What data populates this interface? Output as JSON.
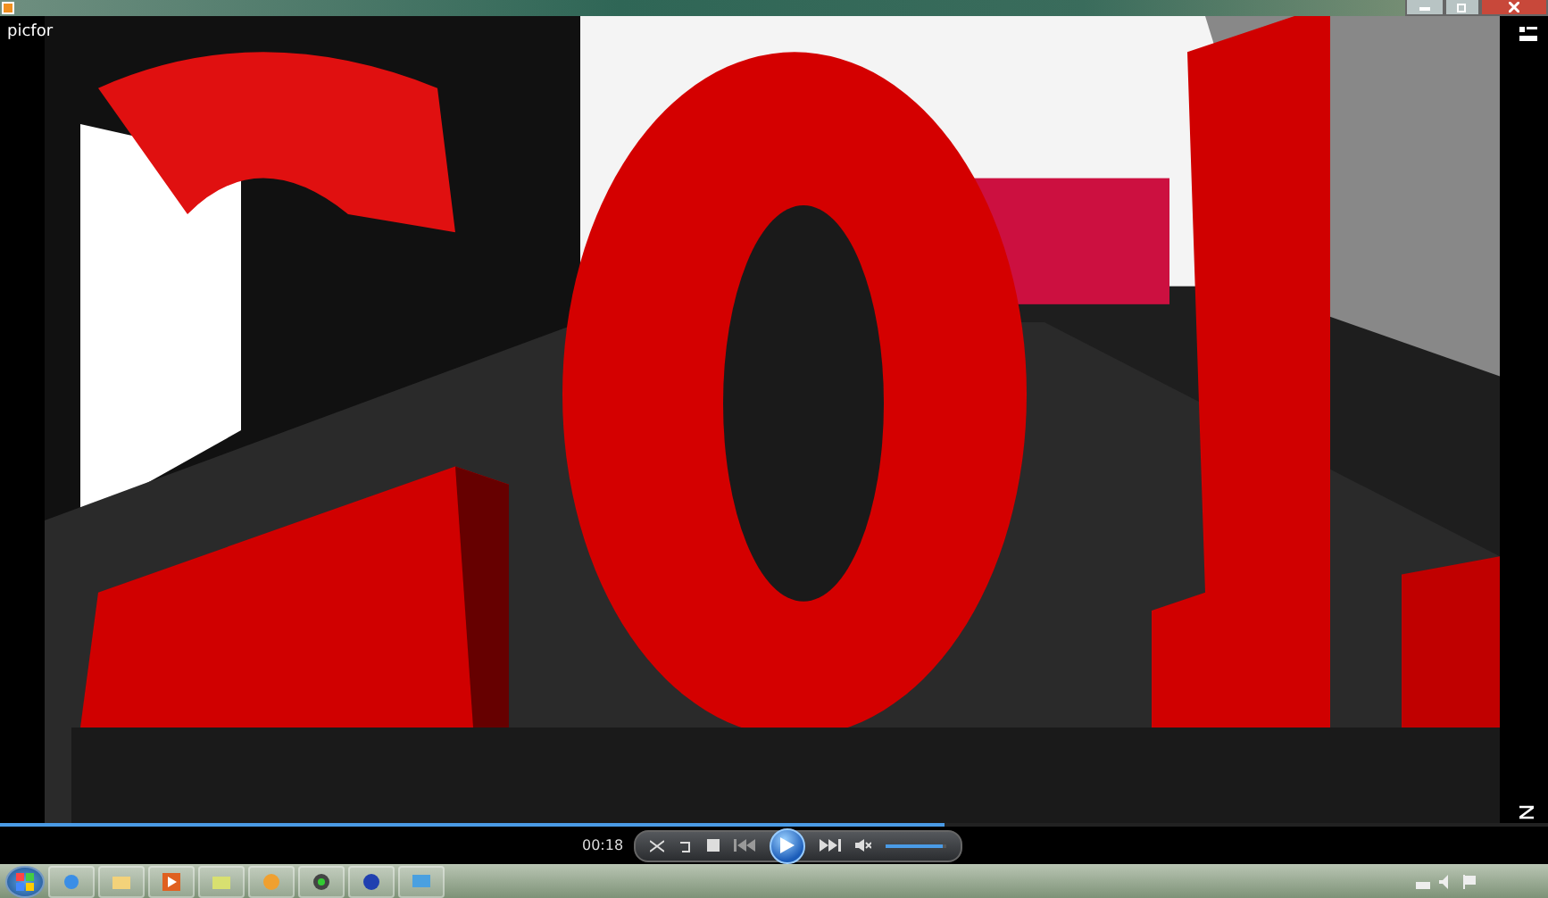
{
  "window": {
    "title": "picfor"
  },
  "player": {
    "elapsed": "00:18",
    "progress": {
      "level": 0.61
    },
    "volume": {
      "level": 0.93
    },
    "playing": false
  }
}
